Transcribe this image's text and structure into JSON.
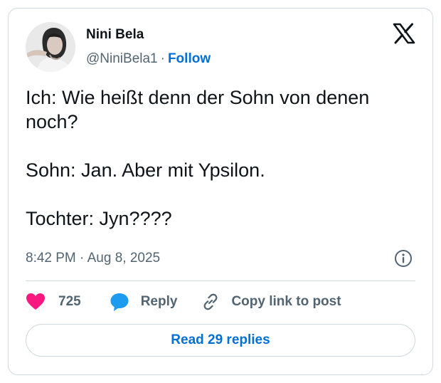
{
  "author": {
    "name": "Nini Bela",
    "handle": "@NiniBela1",
    "separator": "·",
    "follow_label": "Follow"
  },
  "tweet": {
    "lines": [
      "Ich: Wie heißt denn der Sohn von denen noch?",
      "Sohn: Jan. Aber mit Ypsilon.",
      "Tochter: Jyn????"
    ]
  },
  "meta": {
    "time": "8:42 PM",
    "separator": "·",
    "date": "Aug 8, 2025"
  },
  "actions": {
    "like_count": "725",
    "reply_label": "Reply",
    "copy_label": "Copy link to post"
  },
  "read_replies_label": "Read 29 replies",
  "colors": {
    "link_blue": "#006fd6",
    "heart": "#f91880",
    "reply_bubble": "#1d9bf0",
    "muted_text": "#536471",
    "border": "#cfd9de"
  },
  "icons": {
    "brand": "x-logo-icon",
    "like": "heart-icon",
    "reply": "speech-bubble-icon",
    "copy": "link-icon",
    "info": "info-icon"
  }
}
